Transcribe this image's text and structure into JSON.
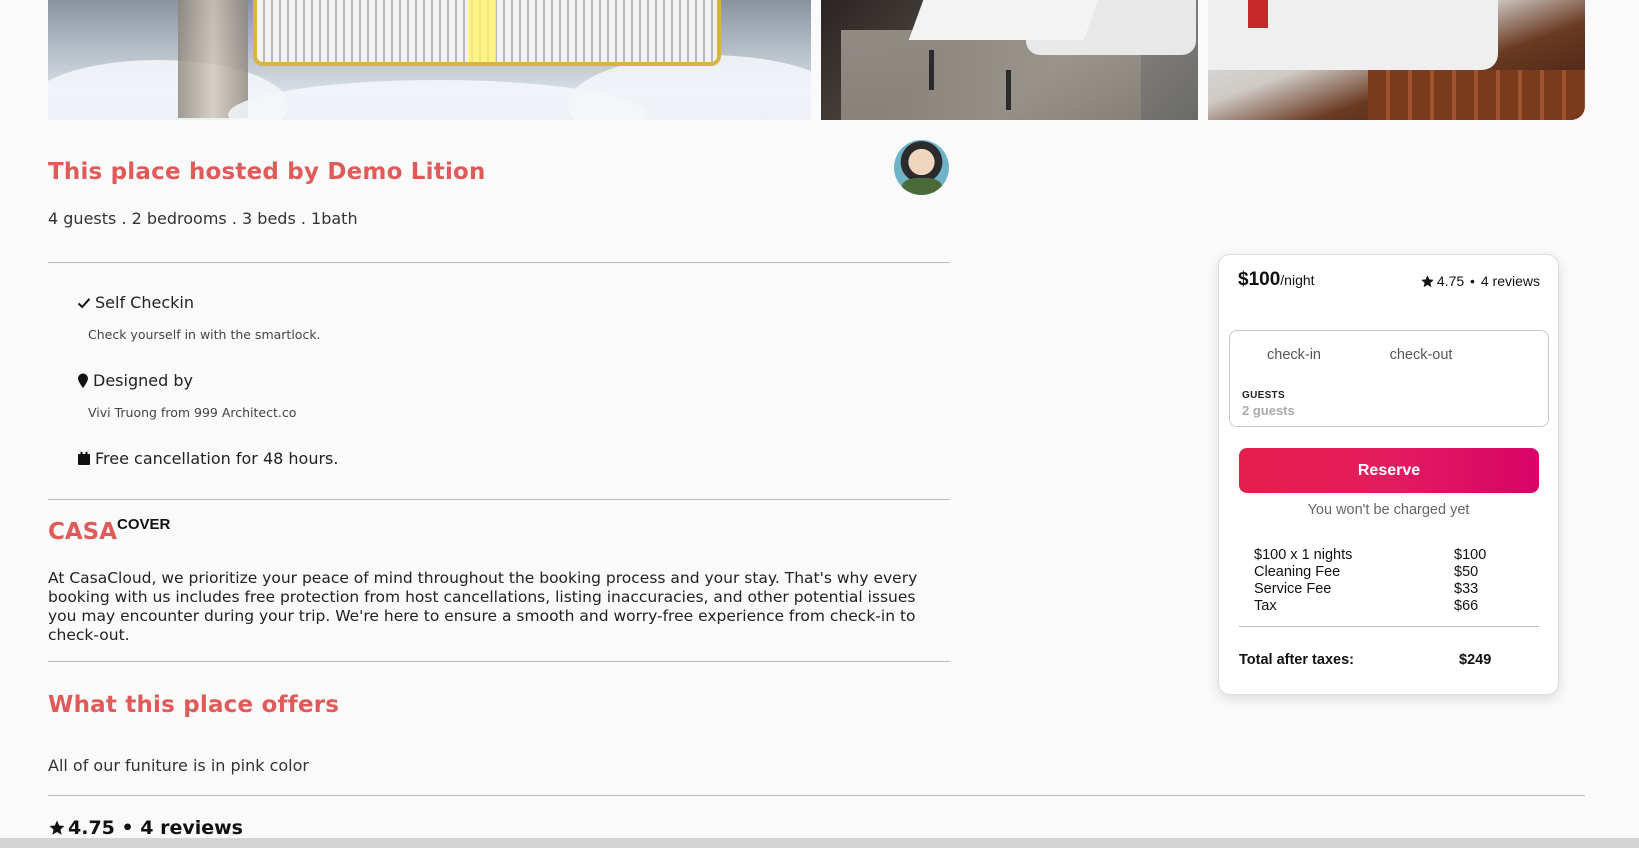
{
  "listing": {
    "host_title": "This place hosted by Demo Lition",
    "summary": "4 guests . 2 bedrooms . 3 beds . 1bath"
  },
  "features": [
    {
      "icon": "check-icon",
      "title": "Self Checkin",
      "desc": "Check yourself in with the smartlock."
    },
    {
      "icon": "map-pin-icon",
      "title": "Designed by",
      "desc": "Vivi Truong from 999 Architect.co"
    },
    {
      "icon": "calendar-icon",
      "title": "Free cancellation for 48 hours.",
      "desc": ""
    }
  ],
  "casacover": {
    "brand": "CASA",
    "suffix": "COVER",
    "text": "At CasaCloud, we prioritize your peace of mind throughout the booking process and your stay. That's why every booking with us includes free protection from host cancellations, listing inaccuracies, and other potential issues you may encounter during your trip. We're here to ensure a smooth and worry-free experience from check-in to check-out."
  },
  "offers": {
    "title": "What this place offers",
    "text": "All of our funiture is in pink color"
  },
  "reviews": {
    "summary": "4.75 • 4 reviews"
  },
  "booking": {
    "price_amount": "$100",
    "price_unit": "/night",
    "rating": "4.75",
    "rating_separator": " • ",
    "reviews": "4 reviews",
    "checkin_placeholder": "check-in",
    "checkout_placeholder": "check-out",
    "guests_label": "GUESTS",
    "guests_value": "2 guests",
    "reserve_label": "Reserve",
    "no_charge_note": "You won't be charged yet",
    "fees": [
      {
        "label": "$100 x 1 nights",
        "amount": "$100"
      },
      {
        "label": "Cleaning Fee",
        "amount": "$50"
      },
      {
        "label": "Service Fee",
        "amount": "$33"
      },
      {
        "label": "Tax",
        "amount": "$66"
      }
    ],
    "total_label": "Total after taxes:",
    "total_amount": "$249"
  },
  "colors": {
    "accent": "#e05a5a",
    "reserve_gradient_start": "#e61e4d",
    "reserve_gradient_end": "#d70466"
  }
}
